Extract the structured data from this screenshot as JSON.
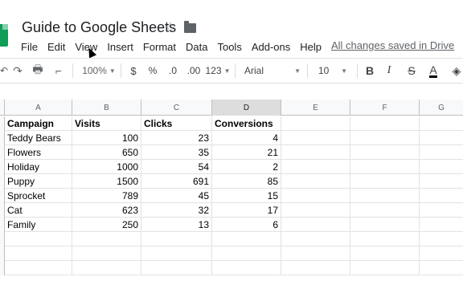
{
  "header": {
    "title": "Guide to Google Sheets",
    "save_status": "All changes saved in Drive"
  },
  "menu": [
    "File",
    "Edit",
    "View",
    "Insert",
    "Format",
    "Data",
    "Tools",
    "Add-ons",
    "Help"
  ],
  "toolbar": {
    "zoom": "100%",
    "currency": "$",
    "percent": "%",
    "decrease_decimals": ".0",
    "increase_decimals": ".00",
    "more_formats": "123",
    "font": "Arial",
    "font_size": "10",
    "bold": "B",
    "italic": "I",
    "strikethrough": "S",
    "text_color": "A"
  },
  "columns": [
    "A",
    "B",
    "C",
    "D",
    "E",
    "F",
    "G"
  ],
  "selected_column": "D",
  "table": {
    "headers": [
      "Campaign",
      "Visits",
      "Clicks",
      "Conversions"
    ],
    "rows": [
      [
        "Teddy Bears",
        "100",
        "23",
        "4"
      ],
      [
        "Flowers",
        "650",
        "35",
        "21"
      ],
      [
        "Holiday",
        "1000",
        "54",
        "2"
      ],
      [
        "Puppy",
        "1500",
        "691",
        "85"
      ],
      [
        "Sprocket",
        "789",
        "45",
        "15"
      ],
      [
        "Cat",
        "623",
        "32",
        "17"
      ],
      [
        "Family",
        "250",
        "13",
        "6"
      ]
    ]
  },
  "colors": {
    "sheets_green": "#0f9d58",
    "selected_header": "#dddddd"
  }
}
